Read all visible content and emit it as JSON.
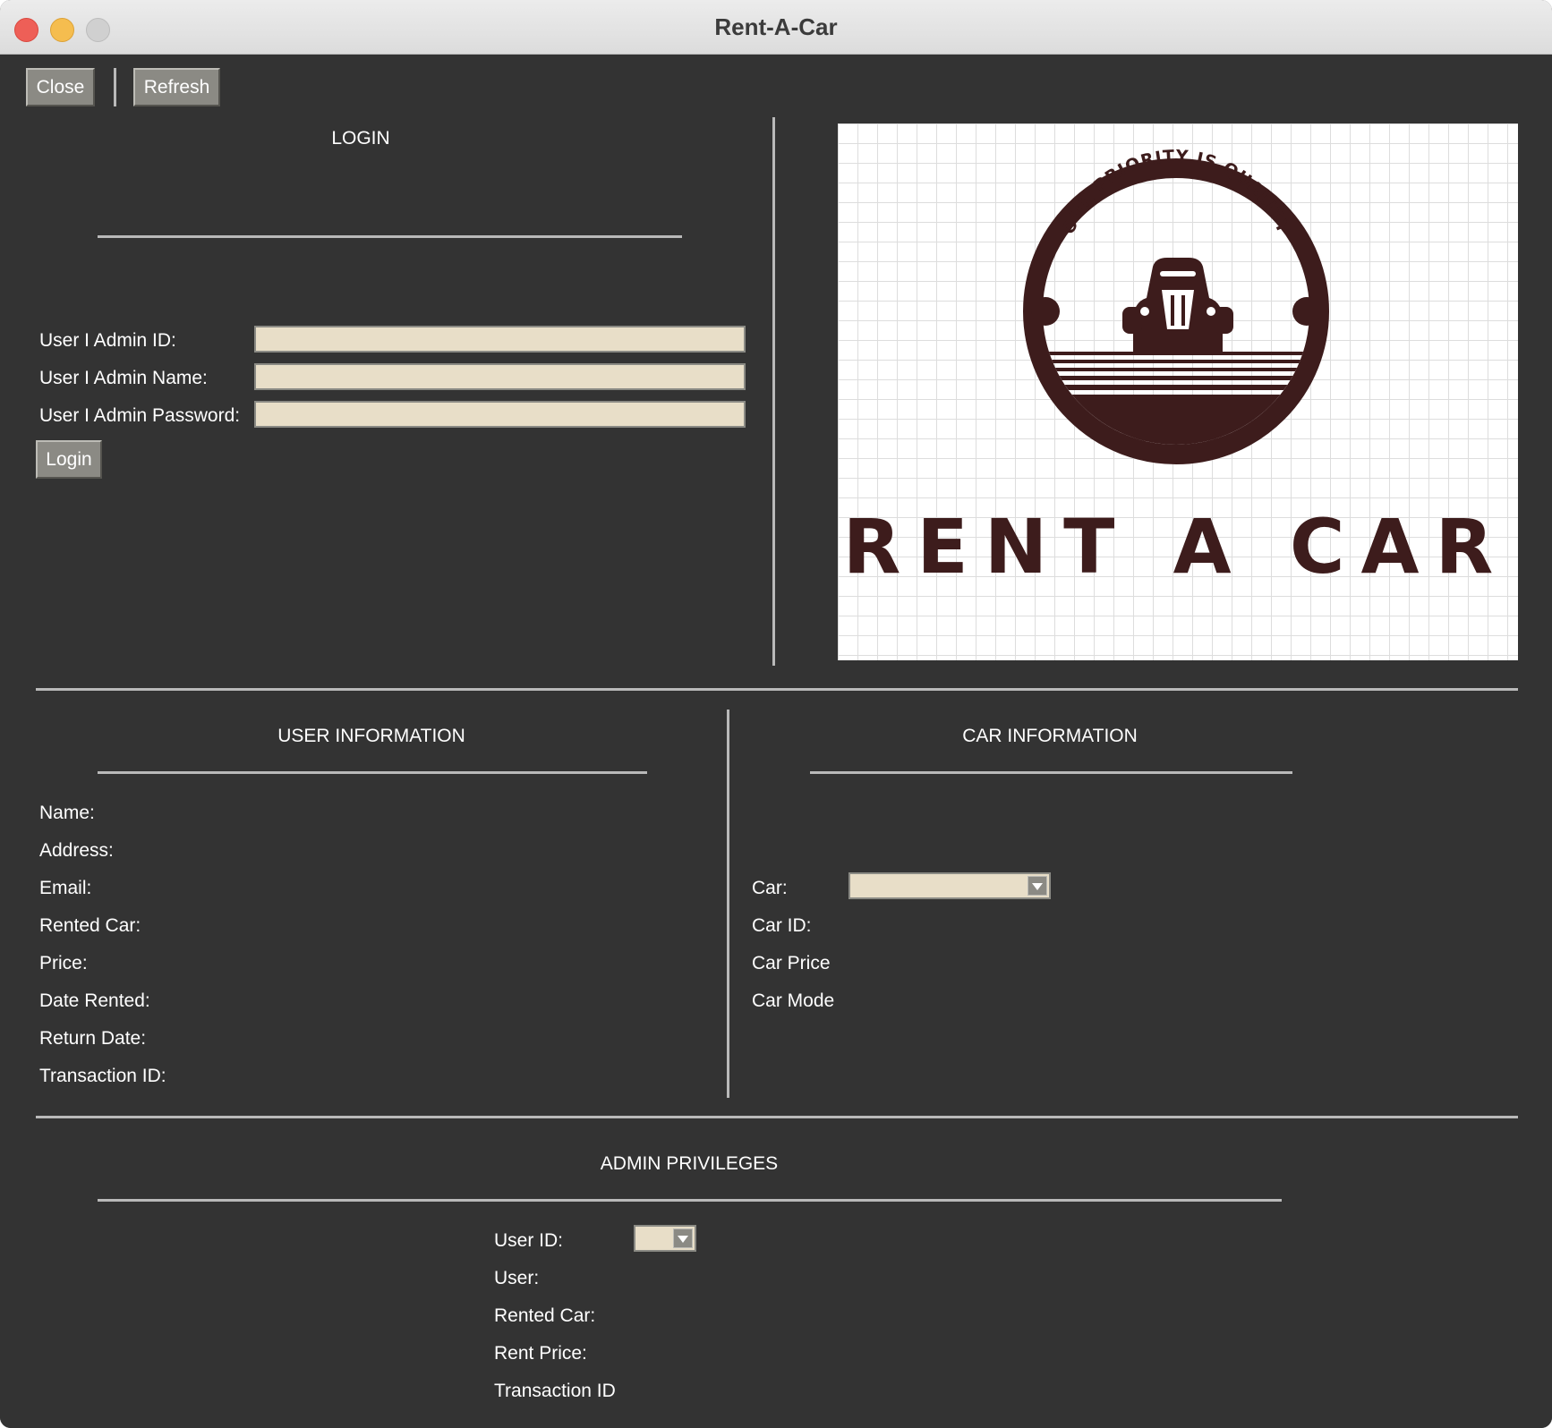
{
  "window": {
    "title": "Rent-A-Car"
  },
  "toolbar": {
    "close_label": "Close",
    "refresh_label": "Refresh"
  },
  "login": {
    "heading": "LOGIN",
    "id_label": "User I Admin ID:",
    "name_label": "User I Admin Name:",
    "password_label": "User I Admin Password:",
    "id_value": "",
    "name_value": "",
    "password_value": "",
    "login_label": "Login"
  },
  "logo": {
    "arc_text": "OUR PRIORITY IS QUALITY",
    "brand_text": "RENT A CAR",
    "brand_color": "#3d1c1c"
  },
  "user_info": {
    "heading": "USER INFORMATION",
    "labels": [
      "Name:",
      "Address:",
      "Email:",
      "Rented Car:",
      "Price:",
      "Date Rented:",
      "Return Date:",
      "Transaction ID:"
    ]
  },
  "car_info": {
    "heading": "CAR INFORMATION",
    "car_label": "Car:",
    "car_selected": "",
    "car_id_label": "Car ID:",
    "car_price_label": "Car Price",
    "car_model_label": "Car Mode"
  },
  "admin": {
    "heading": "ADMIN PRIVILEGES",
    "user_id_label": "User ID:",
    "user_id_selected": "",
    "user_label": "User:",
    "rented_car_label": "Rented Car:",
    "rent_price_label": "Rent Price:",
    "transaction_label": "Transaction ID"
  },
  "colors": {
    "background": "#333333",
    "field": "#e8dec8",
    "button": "#8b8a84",
    "text": "#ffffff"
  }
}
